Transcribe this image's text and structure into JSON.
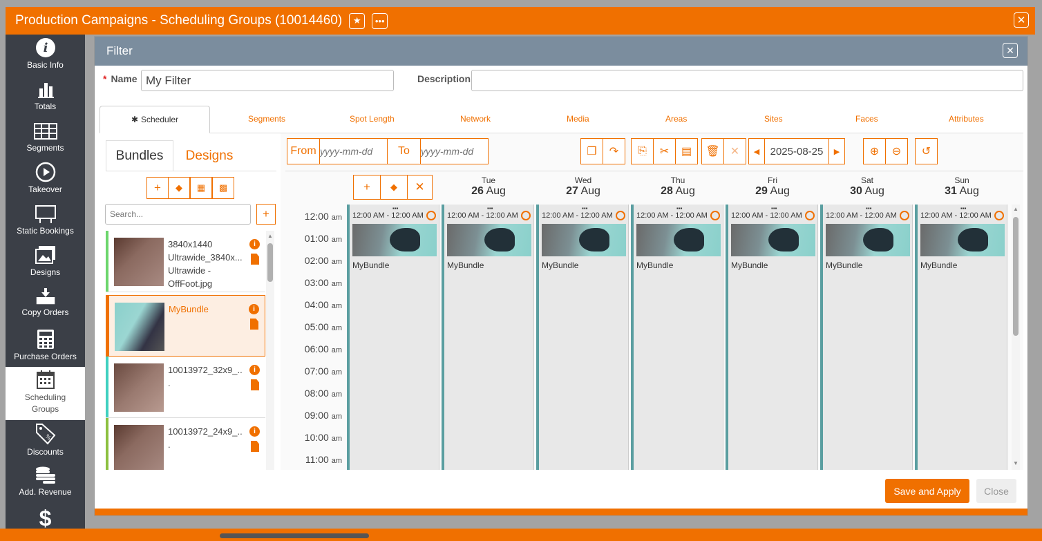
{
  "window": {
    "title": "Production Campaigns - Scheduling Groups (10014460)"
  },
  "sidebar": {
    "items": [
      {
        "label": "Basic Info",
        "icon": "info-icon"
      },
      {
        "label": "Totals",
        "icon": "bar-chart-icon"
      },
      {
        "label": "Segments",
        "icon": "grid-icon"
      },
      {
        "label": "Takeover",
        "icon": "play-icon"
      },
      {
        "label": "Static Bookings",
        "icon": "billboard-icon"
      },
      {
        "label": "Designs",
        "icon": "images-icon"
      },
      {
        "label": "Copy Orders",
        "icon": "download-tray-icon"
      },
      {
        "label": "Purchase Orders",
        "icon": "calculator-icon"
      },
      {
        "label": "Scheduling Groups",
        "icon": "calendar-icon"
      },
      {
        "label": "Discounts",
        "icon": "tag-icon"
      },
      {
        "label": "Add. Revenue",
        "icon": "coins-icon"
      },
      {
        "label": "",
        "icon": "dollar-icon"
      }
    ]
  },
  "dialog": {
    "title": "Filter",
    "name_label": "Name",
    "name_value": "My Filter",
    "description_label": "Description",
    "description_value": "",
    "tabs": [
      "Scheduler",
      "Segments",
      "Spot Length",
      "Network",
      "Media",
      "Areas",
      "Sites",
      "Faces",
      "Attributes"
    ],
    "save_label": "Save and Apply",
    "close_label": "Close"
  },
  "left_panel": {
    "subtabs": [
      "Bundles",
      "Designs"
    ],
    "search_placeholder": "Search...",
    "bundles": [
      {
        "name": "3840x1440 Ultrawide_3840x... Ultrawide - OffFoot.jpg",
        "strip": "#6cd66c",
        "selected": false
      },
      {
        "name": "MyBundle",
        "strip": "#f07000",
        "selected": true
      },
      {
        "name": "10013972_32x9_...",
        "strip": "#40d0c0",
        "selected": false
      },
      {
        "name": "10013972_24x9_...",
        "strip": "#8cc040",
        "selected": false
      }
    ]
  },
  "scheduler": {
    "from_label": "From",
    "to_label": "To",
    "date_placeholder": "yyyy-mm-dd",
    "current_date": "2025-08-25",
    "days": [
      {
        "dow": "Tue",
        "num": "26",
        "mon": "Aug"
      },
      {
        "dow": "Wed",
        "num": "27",
        "mon": "Aug"
      },
      {
        "dow": "Thu",
        "num": "28",
        "mon": "Aug"
      },
      {
        "dow": "Fri",
        "num": "29",
        "mon": "Aug"
      },
      {
        "dow": "Sat",
        "num": "30",
        "mon": "Aug"
      },
      {
        "dow": "Sun",
        "num": "31",
        "mon": "Aug"
      }
    ],
    "hours": [
      {
        "t": "12:00",
        "ap": "am"
      },
      {
        "t": "01:00",
        "ap": "am"
      },
      {
        "t": "02:00",
        "ap": "am"
      },
      {
        "t": "03:00",
        "ap": "am"
      },
      {
        "t": "04:00",
        "ap": "am"
      },
      {
        "t": "05:00",
        "ap": "am"
      },
      {
        "t": "06:00",
        "ap": "am"
      },
      {
        "t": "07:00",
        "ap": "am"
      },
      {
        "t": "08:00",
        "ap": "am"
      },
      {
        "t": "09:00",
        "ap": "am"
      },
      {
        "t": "10:00",
        "ap": "am"
      },
      {
        "t": "11:00",
        "ap": "am"
      }
    ],
    "event_time": "12:00 AM - 12:00 AM",
    "event_name": "MyBundle"
  },
  "colors": {
    "accent": "#f07000",
    "header": "#7b8d9e",
    "sidebar": "#3b3f47"
  }
}
